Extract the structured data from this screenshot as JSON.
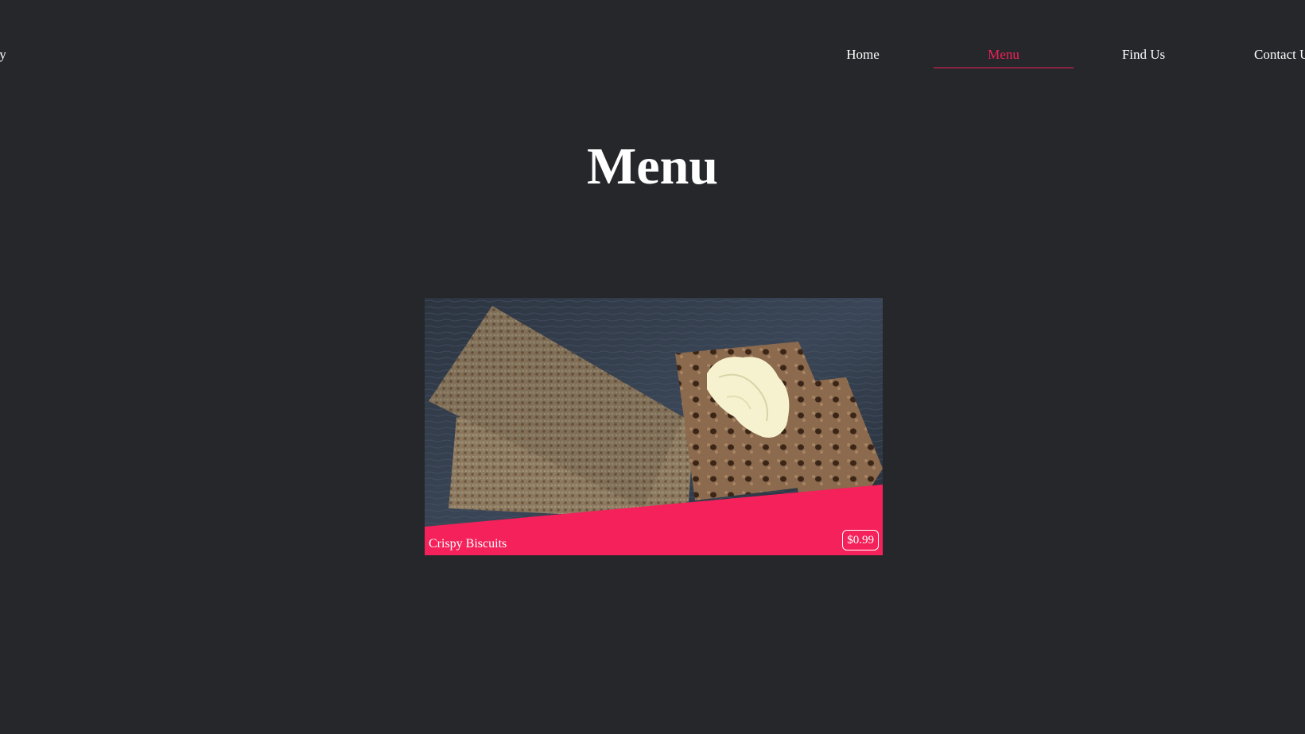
{
  "header": {
    "brand": "akery",
    "nav": {
      "home": "Home",
      "menu": "Menu",
      "find_us": "Find Us",
      "contact": "Contact Us"
    },
    "active_item": "Menu",
    "accent_color": "#f4215a"
  },
  "main": {
    "title": "Menu",
    "items": [
      {
        "name": "Crispy Biscuits",
        "price": "$0.99",
        "image": "crispbread-with-butter"
      }
    ]
  },
  "colors": {
    "background": "#26272b",
    "text": "#ffffff",
    "accent": "#f4215a"
  }
}
